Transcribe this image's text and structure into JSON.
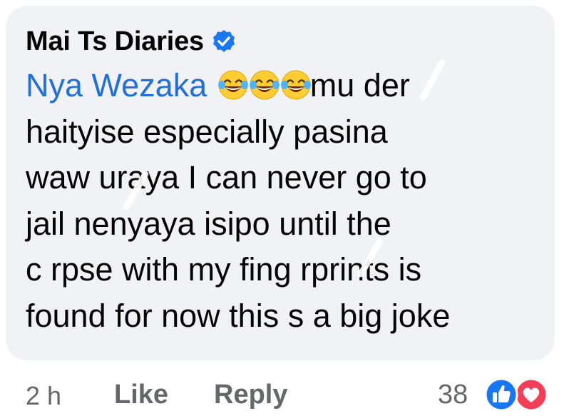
{
  "comment": {
    "author": "Mai Ts Diaries",
    "mention": "Nya Wezaka",
    "lines": [
      "mu der",
      "haityise especially pasina",
      "waw uraya I can never go to",
      "jail nenyaya isipo until the",
      "c rpse with my fing rprints is",
      "found for now this s a big joke"
    ]
  },
  "footer": {
    "time": "2 h",
    "like_label": "Like",
    "reply_label": "Reply",
    "reaction_count": "38"
  },
  "colors": {
    "bubble_bg": "#f0f2f5",
    "mention": "#216fdb",
    "meta_text": "#65676b",
    "like_blue": "#1877f2",
    "love_red": "#f33e58",
    "verified_blue": "#1877f2"
  },
  "icons": {
    "verified": "verified-badge-icon",
    "emoji": "tears-of-joy-emoji-icon",
    "like_reaction": "thumbs-up-reaction-icon",
    "love_reaction": "heart-reaction-icon"
  }
}
